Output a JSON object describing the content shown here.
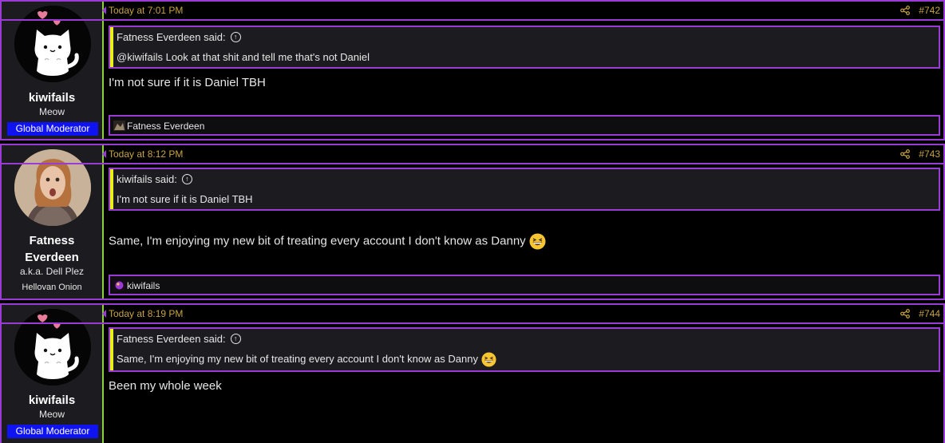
{
  "posts": [
    {
      "author": "kiwifails",
      "user_title": "Meow",
      "banner": "Global Moderator",
      "date": "Today at 7:01 PM",
      "number": "#742",
      "quote": {
        "author_said": "Fatness Everdeen said:",
        "text": "@kiwifails Look at that shit and tell me that's not Daniel"
      },
      "text": "I'm not sure if it is Daniel TBH",
      "reaction_user": "Fatness Everdeen"
    },
    {
      "author_line1": "Fatness",
      "author_line2": "Everdeen",
      "user_title": "a.k.a. Dell Plez",
      "user_rank": "Hellovan Onion",
      "date": "Today at 8:12 PM",
      "number": "#743",
      "quote": {
        "author_said": "kiwifails said:",
        "text": "I'm not sure if it is Daniel TBH"
      },
      "text": "Same, I'm enjoying my new bit of treating every account I don't know as Danny",
      "reaction_user": "kiwifails"
    },
    {
      "author": "kiwifails",
      "user_title": "Meow",
      "banner": "Global Moderator",
      "date": "Today at 8:19 PM",
      "number": "#744",
      "quote": {
        "author_said": "Fatness Everdeen said:",
        "text": "Same, I'm enjoying my new bit of treating every account I don't know as Danny"
      },
      "text": "Been my whole week"
    }
  ],
  "icons": {
    "share": "share-icon",
    "quote_jump": "arrow-up-circle-icon",
    "emoji": "grinning-squinting-face-icon"
  },
  "colors": {
    "accent_border": "#9b3bd6",
    "quote_bar": "#e8f21a",
    "date": "#c9a341",
    "banner": "#0f13f2",
    "user_divider": "#8bd23a"
  }
}
